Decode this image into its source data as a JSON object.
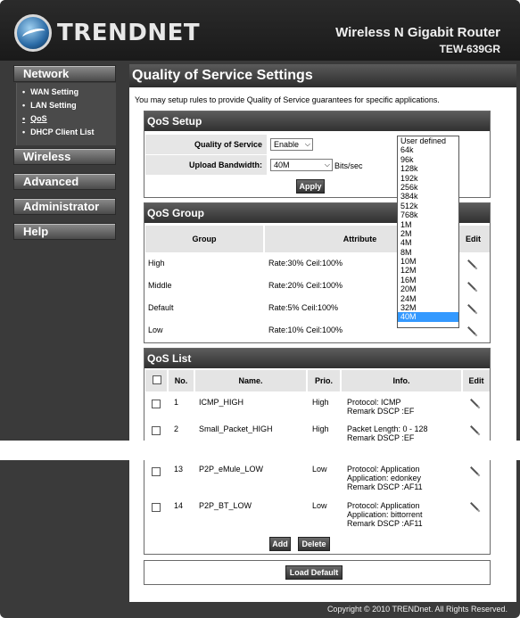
{
  "header": {
    "brand": "TRENDNET",
    "product_name": "Wireless N Gigabit Router",
    "model": "TEW-639GR"
  },
  "nav": {
    "network": "Network",
    "network_items": [
      "WAN Setting",
      "LAN Setting",
      "QoS",
      "DHCP Client List"
    ],
    "wireless": "Wireless",
    "advanced": "Advanced",
    "administrator": "Administrator",
    "help": "Help"
  },
  "page": {
    "title": "Quality of Service Settings",
    "intro": "You may setup rules to provide Quality of Service guarantees for specific applications."
  },
  "qos_setup": {
    "heading": "QoS Setup",
    "qos_label": "Quality of Service",
    "qos_value": "Enable",
    "upload_label": "Upload Bandwidth:",
    "upload_value": "40M",
    "upload_unit": "Bits/sec",
    "apply": "Apply"
  },
  "bandwidth_options": [
    "User defined",
    "64k",
    "96k",
    "128k",
    "192k",
    "256k",
    "384k",
    "512k",
    "768k",
    "1M",
    "2M",
    "4M",
    "8M",
    "10M",
    "12M",
    "16M",
    "20M",
    "24M",
    "32M",
    "40M"
  ],
  "qos_group": {
    "heading": "QoS Group",
    "columns": [
      "Group",
      "Attribute",
      "Edit"
    ],
    "rows": [
      {
        "group": "High",
        "attribute": "Rate:30% Ceil:100%"
      },
      {
        "group": "Middle",
        "attribute": "Rate:20% Ceil:100%"
      },
      {
        "group": "Default",
        "attribute": "Rate:5% Ceil:100%"
      },
      {
        "group": "Low",
        "attribute": "Rate:10% Ceil:100%"
      }
    ]
  },
  "qos_list": {
    "heading": "QoS List",
    "columns": [
      "No.",
      "Name.",
      "Prio.",
      "Info.",
      "Edit"
    ],
    "rows": [
      {
        "no": "1",
        "name": "ICMP_HIGH",
        "prio": "High",
        "info1": "Protocol: ICMP",
        "info2": "Remark DSCP :EF",
        "info3": ""
      },
      {
        "no": "2",
        "name": "Small_Packet_HIGH",
        "prio": "High",
        "info1": "Packet Length: 0 - 128",
        "info2": "Remark DSCP :EF",
        "info3": ""
      },
      {
        "no": "13",
        "name": "P2P_eMule_LOW",
        "prio": "Low",
        "info1": "Protocol: Application",
        "info2": "Application: edonkey",
        "info3": "Remark DSCP :AF11"
      },
      {
        "no": "14",
        "name": "P2P_BT_LOW",
        "prio": "Low",
        "info1": "Protocol: Application",
        "info2": "Application: bittorrent",
        "info3": "Remark DSCP :AF11"
      }
    ],
    "add": "Add",
    "delete": "Delete"
  },
  "load_default": "Load Default",
  "footer": "Copyright © 2010 TRENDnet. All Rights Reserved."
}
